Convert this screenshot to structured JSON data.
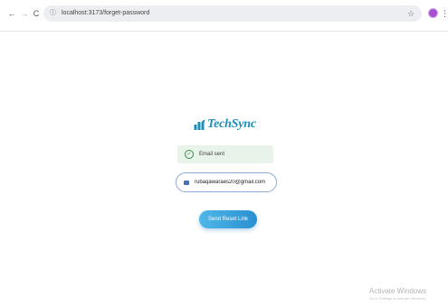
{
  "browser": {
    "url": "localhost:3173/forget-password",
    "back_glyph": "←",
    "forward_glyph": "→",
    "reload_glyph": "C",
    "site_info_glyph": "ⓘ",
    "bookmark_glyph": "☆",
    "menu_glyph": "⋮",
    "icons": [
      "back-arrow-icon",
      "forward-arrow-icon",
      "reload-icon",
      "site-info-icon",
      "bookmark-star-icon",
      "profile-icon",
      "menu-icon"
    ],
    "profile_color": "#a64fd1"
  },
  "brand": {
    "name": "TechSync",
    "color": "#1a8fb8"
  },
  "status": {
    "text": "Email sent",
    "icon": "check-circle-icon",
    "icon_glyph": "✓",
    "background": "#e8f4ea"
  },
  "email_field": {
    "value": "rubaqawaraes20@gmail.com",
    "icon": "mail-icon",
    "border_color": "#8ea8d6"
  },
  "send_button": {
    "label": "Send Reset Link",
    "color_start": "#4fb8e8",
    "color_end": "#2a8fd0"
  },
  "watermark": {
    "title": "Activate Windows",
    "subtitle": "Go to Settings to activate Windows."
  }
}
